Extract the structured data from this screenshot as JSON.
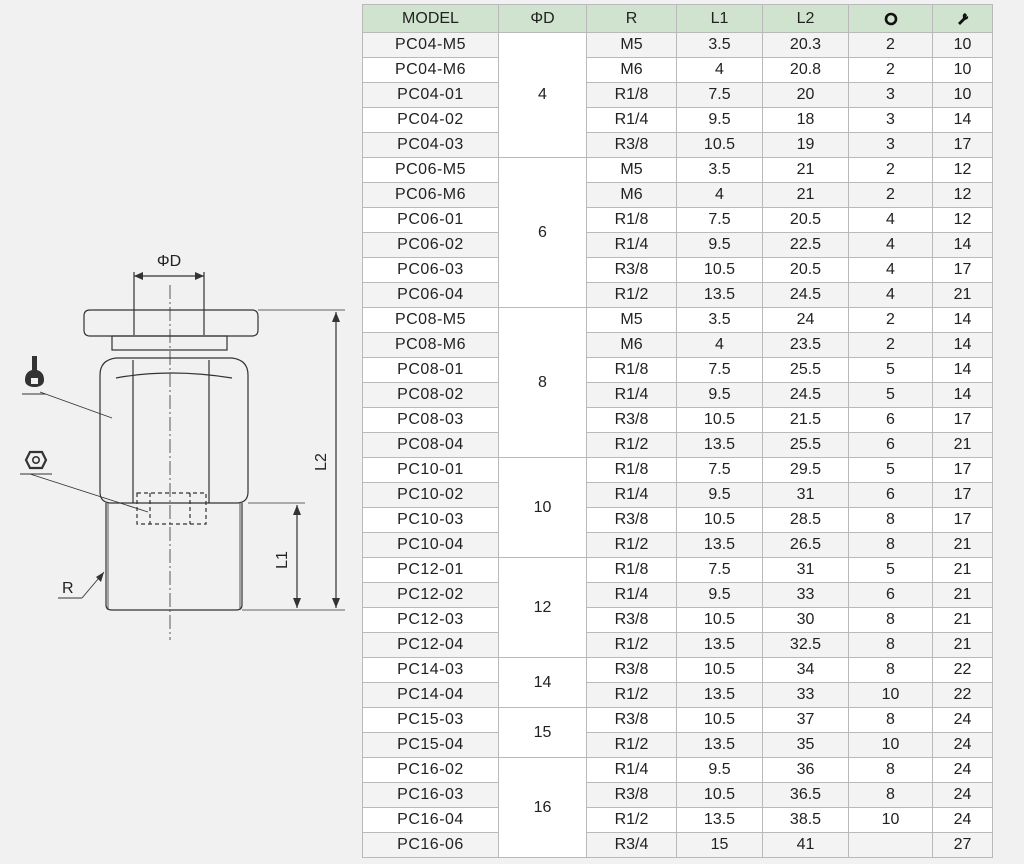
{
  "table": {
    "headers": {
      "model": "MODEL",
      "od": "ΦD",
      "r": "R",
      "l1": "L1",
      "l2": "L2",
      "hex_icon": "hex-nut-icon",
      "wrench_icon": "wrench-icon"
    },
    "groups": [
      {
        "od": "4",
        "rows": [
          {
            "model": "PC04-M5",
            "r": "M5",
            "l1": "3.5",
            "l2": "20.3",
            "hex": "2",
            "wrench": "10"
          },
          {
            "model": "PC04-M6",
            "r": "M6",
            "l1": "4",
            "l2": "20.8",
            "hex": "2",
            "wrench": "10"
          },
          {
            "model": "PC04-01",
            "r": "R1/8",
            "l1": "7.5",
            "l2": "20",
            "hex": "3",
            "wrench": "10"
          },
          {
            "model": "PC04-02",
            "r": "R1/4",
            "l1": "9.5",
            "l2": "18",
            "hex": "3",
            "wrench": "14"
          },
          {
            "model": "PC04-03",
            "r": "R3/8",
            "l1": "10.5",
            "l2": "19",
            "hex": "3",
            "wrench": "17"
          }
        ]
      },
      {
        "od": "6",
        "rows": [
          {
            "model": "PC06-M5",
            "r": "M5",
            "l1": "3.5",
            "l2": "21",
            "hex": "2",
            "wrench": "12"
          },
          {
            "model": "PC06-M6",
            "r": "M6",
            "l1": "4",
            "l2": "21",
            "hex": "2",
            "wrench": "12"
          },
          {
            "model": "PC06-01",
            "r": "R1/8",
            "l1": "7.5",
            "l2": "20.5",
            "hex": "4",
            "wrench": "12"
          },
          {
            "model": "PC06-02",
            "r": "R1/4",
            "l1": "9.5",
            "l2": "22.5",
            "hex": "4",
            "wrench": "14"
          },
          {
            "model": "PC06-03",
            "r": "R3/8",
            "l1": "10.5",
            "l2": "20.5",
            "hex": "4",
            "wrench": "17"
          },
          {
            "model": "PC06-04",
            "r": "R1/2",
            "l1": "13.5",
            "l2": "24.5",
            "hex": "4",
            "wrench": "21"
          }
        ]
      },
      {
        "od": "8",
        "rows": [
          {
            "model": "PC08-M5",
            "r": "M5",
            "l1": "3.5",
            "l2": "24",
            "hex": "2",
            "wrench": "14"
          },
          {
            "model": "PC08-M6",
            "r": "M6",
            "l1": "4",
            "l2": "23.5",
            "hex": "2",
            "wrench": "14"
          },
          {
            "model": "PC08-01",
            "r": "R1/8",
            "l1": "7.5",
            "l2": "25.5",
            "hex": "5",
            "wrench": "14"
          },
          {
            "model": "PC08-02",
            "r": "R1/4",
            "l1": "9.5",
            "l2": "24.5",
            "hex": "5",
            "wrench": "14"
          },
          {
            "model": "PC08-03",
            "r": "R3/8",
            "l1": "10.5",
            "l2": "21.5",
            "hex": "6",
            "wrench": "17"
          },
          {
            "model": "PC08-04",
            "r": "R1/2",
            "l1": "13.5",
            "l2": "25.5",
            "hex": "6",
            "wrench": "21"
          }
        ]
      },
      {
        "od": "10",
        "rows": [
          {
            "model": "PC10-01",
            "r": "R1/8",
            "l1": "7.5",
            "l2": "29.5",
            "hex": "5",
            "wrench": "17"
          },
          {
            "model": "PC10-02",
            "r": "R1/4",
            "l1": "9.5",
            "l2": "31",
            "hex": "6",
            "wrench": "17"
          },
          {
            "model": "PC10-03",
            "r": "R3/8",
            "l1": "10.5",
            "l2": "28.5",
            "hex": "8",
            "wrench": "17"
          },
          {
            "model": "PC10-04",
            "r": "R1/2",
            "l1": "13.5",
            "l2": "26.5",
            "hex": "8",
            "wrench": "21"
          }
        ]
      },
      {
        "od": "12",
        "rows": [
          {
            "model": "PC12-01",
            "r": "R1/8",
            "l1": "7.5",
            "l2": "31",
            "hex": "5",
            "wrench": "21"
          },
          {
            "model": "PC12-02",
            "r": "R1/4",
            "l1": "9.5",
            "l2": "33",
            "hex": "6",
            "wrench": "21"
          },
          {
            "model": "PC12-03",
            "r": "R3/8",
            "l1": "10.5",
            "l2": "30",
            "hex": "8",
            "wrench": "21"
          },
          {
            "model": "PC12-04",
            "r": "R1/2",
            "l1": "13.5",
            "l2": "32.5",
            "hex": "8",
            "wrench": "21"
          }
        ]
      },
      {
        "od": "14",
        "rows": [
          {
            "model": "PC14-03",
            "r": "R3/8",
            "l1": "10.5",
            "l2": "34",
            "hex": "8",
            "wrench": "22"
          },
          {
            "model": "PC14-04",
            "r": "R1/2",
            "l1": "13.5",
            "l2": "33",
            "hex": "10",
            "wrench": "22"
          }
        ]
      },
      {
        "od": "15",
        "rows": [
          {
            "model": "PC15-03",
            "r": "R3/8",
            "l1": "10.5",
            "l2": "37",
            "hex": "8",
            "wrench": "24"
          },
          {
            "model": "PC15-04",
            "r": "R1/2",
            "l1": "13.5",
            "l2": "35",
            "hex": "10",
            "wrench": "24"
          }
        ]
      },
      {
        "od": "16",
        "rows": [
          {
            "model": "PC16-02",
            "r": "R1/4",
            "l1": "9.5",
            "l2": "36",
            "hex": "8",
            "wrench": "24"
          },
          {
            "model": "PC16-03",
            "r": "R3/8",
            "l1": "10.5",
            "l2": "36.5",
            "hex": "8",
            "wrench": "24"
          },
          {
            "model": "PC16-04",
            "r": "R1/2",
            "l1": "13.5",
            "l2": "38.5",
            "hex": "10",
            "wrench": "24"
          },
          {
            "model": "PC16-06",
            "r": "R3/4",
            "l1": "15",
            "l2": "41",
            "hex": "",
            "wrench": "27"
          }
        ]
      }
    ]
  },
  "drawing": {
    "label_od": "ΦD",
    "label_l2": "L2",
    "label_l1": "L1",
    "label_r": "R",
    "icons": [
      "wrench-icon",
      "hex-nut-icon"
    ]
  },
  "colors": {
    "header_bg": "#cfe3cf",
    "line": "#333333",
    "grid": "#b9b9b9"
  }
}
